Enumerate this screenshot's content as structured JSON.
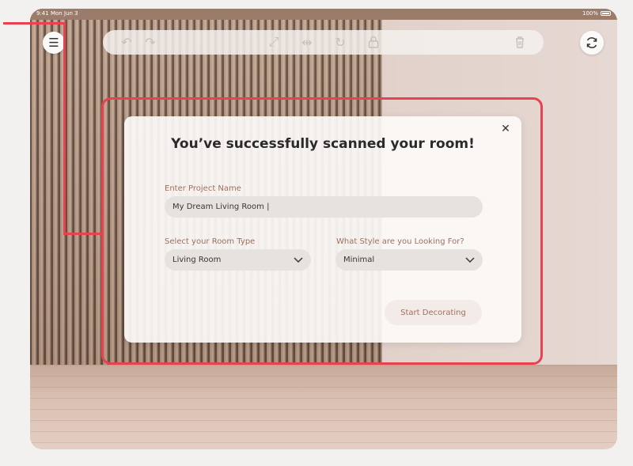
{
  "status_bar": {
    "time": "9:41",
    "date": "Mon Jun 3",
    "battery": "100%"
  },
  "toolbar": {
    "icons": [
      "menu-icon",
      "undo-icon",
      "redo-icon",
      "expand-icon",
      "mirror-icon",
      "rotate-icon",
      "lock-icon",
      "trash-icon",
      "sync-icon"
    ]
  },
  "modal": {
    "title": "You’ve successfully scanned your room!",
    "project_name_label": "Enter Project Name",
    "project_name_value": "My Dream Living Room |",
    "room_type_label": "Select your Room Type",
    "room_type_value": "Living Room",
    "style_label": "What Style are you Looking For?",
    "style_value": "Minimal",
    "start_button": "Start Decorating",
    "close_glyph": "✕"
  },
  "colors": {
    "accent_label": "#a06f5c",
    "highlight_red": "#e8414f"
  }
}
